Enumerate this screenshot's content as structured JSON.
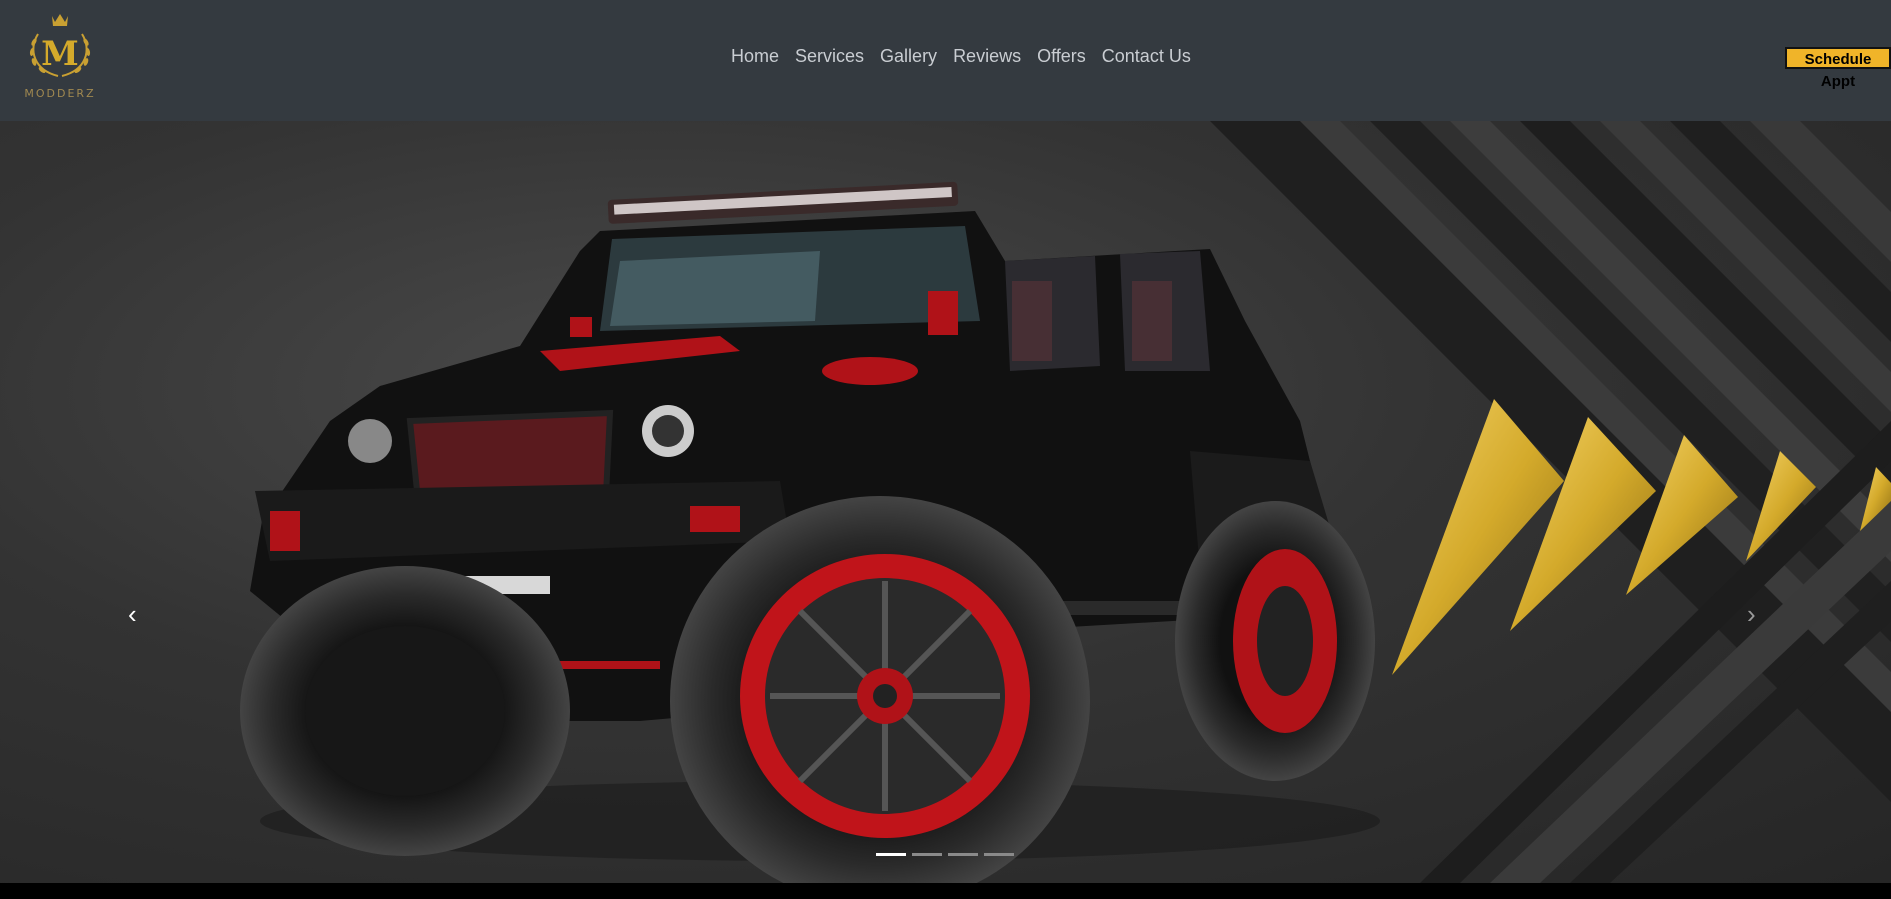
{
  "brand": {
    "logo_letter": "M",
    "logo_text": "MODDERZ",
    "color": "#c9a032"
  },
  "nav": {
    "items": [
      {
        "label": "Home"
      },
      {
        "label": "Services"
      },
      {
        "label": "Gallery"
      },
      {
        "label": "Reviews"
      },
      {
        "label": "Offers"
      },
      {
        "label": "Contact Us"
      }
    ]
  },
  "cta": {
    "label": "Schedule Appt",
    "color": "#f0b429"
  },
  "carousel": {
    "prev_icon": "chevron-left-icon",
    "next_icon": "chevron-right-icon",
    "prev_glyph": "‹",
    "next_glyph": "›",
    "slide_count": 4,
    "active_slide": 1,
    "slide_description_image": "black-jeep-red-wheels"
  },
  "colors": {
    "navbar": "#343a40",
    "accent_gold": "#d4aa2b",
    "jeep_red": "#c0141a"
  }
}
